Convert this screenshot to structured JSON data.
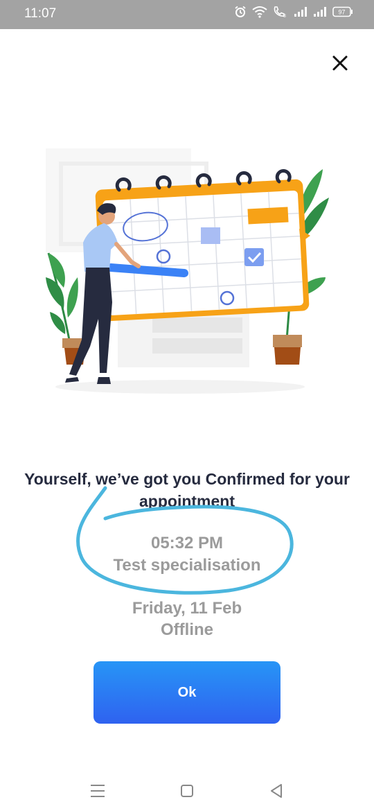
{
  "status_bar": {
    "time": "11:07",
    "battery": "97",
    "icons": [
      "alarm-icon",
      "wifi-icon",
      "volte-call-icon",
      "signal-icon",
      "signal-icon",
      "battery-icon"
    ]
  },
  "dialog": {
    "close_icon": "close-icon",
    "illustration": "calendar-appointment-illustration",
    "title": "Yourself, we’ve got you Confirmed for your appointment",
    "time": "05:32 PM",
    "specialisation": "Test specialisation",
    "date": "Friday, 11 Feb",
    "mode": "Offline",
    "ok_label": "Ok"
  },
  "nav_bar": {
    "buttons": [
      "menu-icon",
      "home-icon",
      "back-icon"
    ]
  },
  "colors": {
    "status_bar": "#a3a3a3",
    "title_text": "#262b3f",
    "info_text": "#9b9b9b",
    "button_top": "#2795f6",
    "button_bottom": "#2f62f0",
    "annotation_stroke": "#4bb6de",
    "calendar_orange": "#f7a217"
  }
}
